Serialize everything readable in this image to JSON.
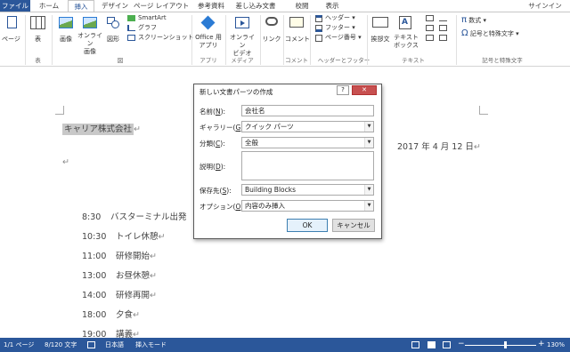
{
  "tabs": {
    "file": "ファイル",
    "home": "ホーム",
    "insert": "挿入",
    "design": "デザイン",
    "layout": "ページ レイアウト",
    "references": "参考資料",
    "mailings": "差し込み文書",
    "review": "校閲",
    "view": "表示",
    "signin": "サインイン"
  },
  "ribbon": {
    "page": "ページ",
    "table": "表",
    "table_group": "表",
    "pictures": "画像",
    "online_pictures": "オンライン\n画像",
    "shapes": "図形",
    "smartart": "SmartArt",
    "chart": "グラフ",
    "screenshot": "スクリーンショット",
    "illustrations_group": "図",
    "office_apps": "Office 用\nアプリ",
    "apps_group": "アプリ",
    "online_video": "オンライン\nビデオ",
    "media_group": "メディア",
    "link": "リンク",
    "comment": "コメント",
    "comment_group": "コメント",
    "header": "ヘッダー",
    "footer": "フッター",
    "page_number": "ページ番号",
    "header_footer_group": "ヘッダーとフッター",
    "quick_parts": "挨拶文",
    "textbox": "テキスト\nボックス",
    "text_group": "テキスト",
    "equation": "数式",
    "symbol": "記号と特殊文字",
    "symbols_group": "記号と特殊文字"
  },
  "document": {
    "selected_text": "キャリア株式会社",
    "date": "2017 年 4 月 12 日",
    "pilcrow": "↵",
    "schedule": [
      {
        "time": "8:30",
        "item": "バスターミナル出発"
      },
      {
        "time": "10:30",
        "item": "トイレ休憩"
      },
      {
        "time": "11:00",
        "item": "研修開始"
      },
      {
        "time": "13:00",
        "item": "お昼休憩"
      },
      {
        "time": "14:00",
        "item": "研修再開"
      },
      {
        "time": "18:00",
        "item": "夕食"
      },
      {
        "time": "19:00",
        "item": "講義"
      }
    ]
  },
  "dialog": {
    "title": "新しい文書パーツの作成",
    "help": "?",
    "close": "✕",
    "name_label": "名前(",
    "name_key": "N",
    "name_value": "会社名",
    "gallery_label": "ギャラリー(",
    "gallery_key": "G",
    "gallery_value": "クイック パーツ",
    "category_label": "分類(",
    "category_key": "C",
    "category_value": "全般",
    "description_label": "説明(",
    "description_key": "D",
    "description_value": "",
    "saveto_label": "保存先(",
    "saveto_key": "S",
    "saveto_value": "Building Blocks",
    "options_label": "オプション(",
    "options_key": "O",
    "options_value": "内容のみ挿入",
    "label_close": "):",
    "ok": "OK",
    "cancel": "キャンセル"
  },
  "status": {
    "page": "1/1 ページ",
    "words": "8/120 文字",
    "language": "日本語",
    "mode": "挿入モード",
    "zoom": "130%"
  },
  "colors": {
    "accent": "#2b579a",
    "selection": "#c8c8c8"
  }
}
